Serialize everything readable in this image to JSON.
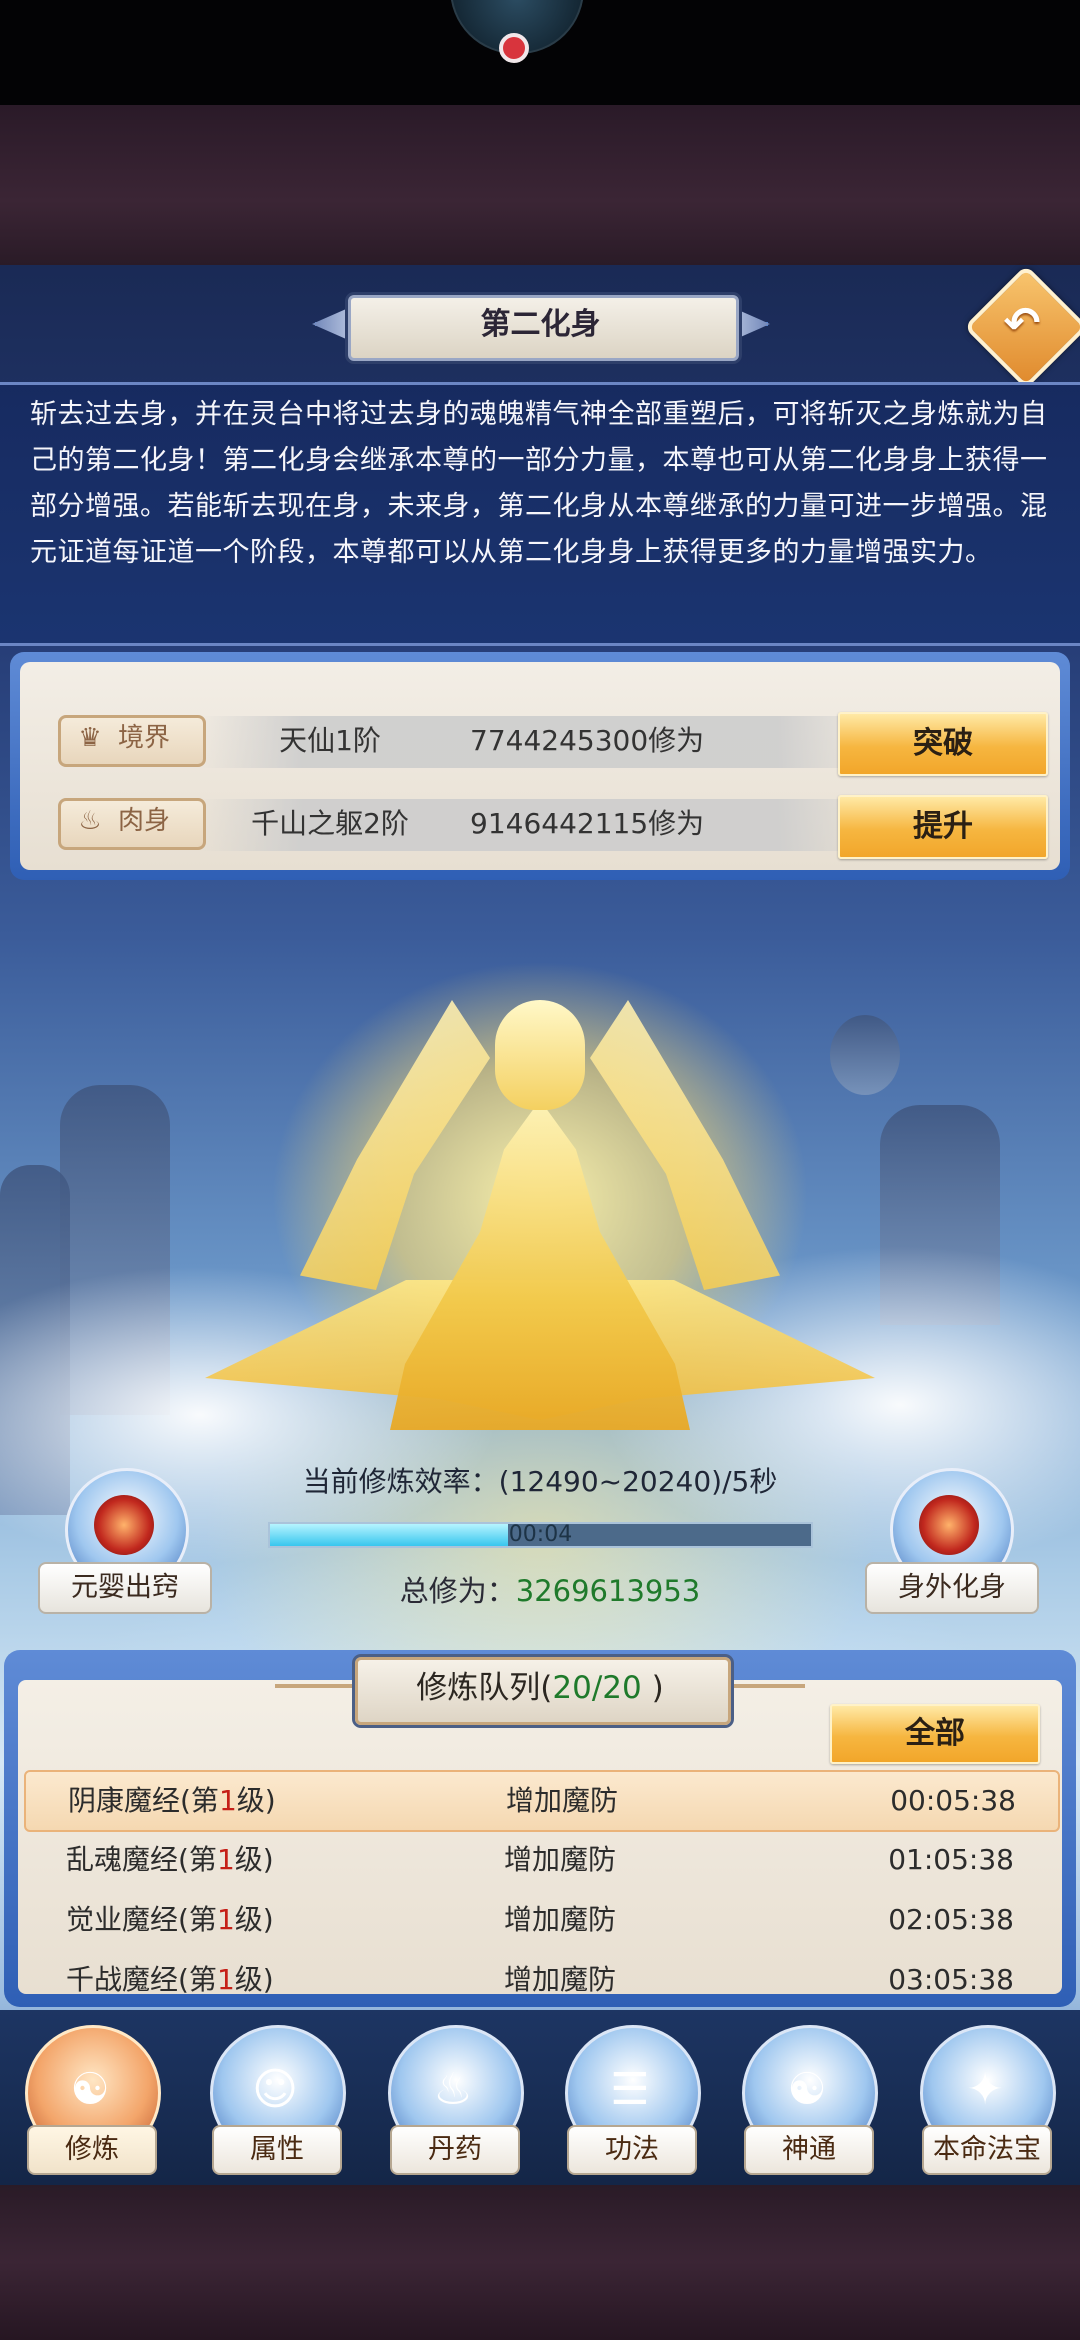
{
  "page": {
    "title": "第二化身",
    "description": "斩去过去身，并在灵台中将过去身的魂魄精气神全部重塑后，可将斩灭之身炼就为自己的第二化身！第二化身会继承本尊的一部分力量，本尊也可从第二化身身上获得一部分增强。若能斩去现在身，未来身，第二化身从本尊继承的力量可进一步增强。混元证道每证道一个阶段，本尊都可以从第二化身身上获得更多的力量增强实力。"
  },
  "stats": [
    {
      "label": "境界",
      "icon": "crown-icon",
      "name": "天仙1阶",
      "value": "7744245300修为",
      "button": "突破"
    },
    {
      "label": "肉身",
      "icon": "flame-icon",
      "name": "千山之躯2阶",
      "value": "9146442115修为",
      "button": "提升"
    }
  ],
  "side_buttons": {
    "left": "元婴出窍",
    "right": "身外化身"
  },
  "cultivation": {
    "efficiency": "当前修炼效率：(12490~20240)/5秒",
    "timer": "00:04",
    "progress": 0.44,
    "total_label": "总修为：",
    "total_value": "3269613953"
  },
  "queue": {
    "title_prefix": "修炼队列(",
    "title_count": "20/20",
    "title_suffix": " )",
    "all_button": "全部",
    "rows": [
      {
        "name": "阴康魔经(第",
        "level": "1",
        "suffix": "级)",
        "effect": "增加魔防",
        "time": "00:05:38"
      },
      {
        "name": "乱魂魔经(第",
        "level": "1",
        "suffix": "级)",
        "effect": "增加魔防",
        "time": "01:05:38"
      },
      {
        "name": "觉业魔经(第",
        "level": "1",
        "suffix": "级)",
        "effect": "增加魔防",
        "time": "02:05:38"
      },
      {
        "name": "千战魔经(第",
        "level": "1",
        "suffix": "级)",
        "effect": "增加魔防",
        "time": "03:05:38"
      }
    ]
  },
  "nav": [
    {
      "label": "修炼",
      "icon": "meditation-icon"
    },
    {
      "label": "属性",
      "icon": "character-icon"
    },
    {
      "label": "丹药",
      "icon": "cauldron-icon"
    },
    {
      "label": "功法",
      "icon": "scroll-icon"
    },
    {
      "label": "神通",
      "icon": "book-icon"
    },
    {
      "label": "本命法宝",
      "icon": "treasure-icon"
    }
  ],
  "colors": {
    "accent_gold": "#f6b640",
    "panel_blue": "#2f5fb5",
    "level_red": "#c51f17",
    "total_green": "#1f7a2b"
  }
}
